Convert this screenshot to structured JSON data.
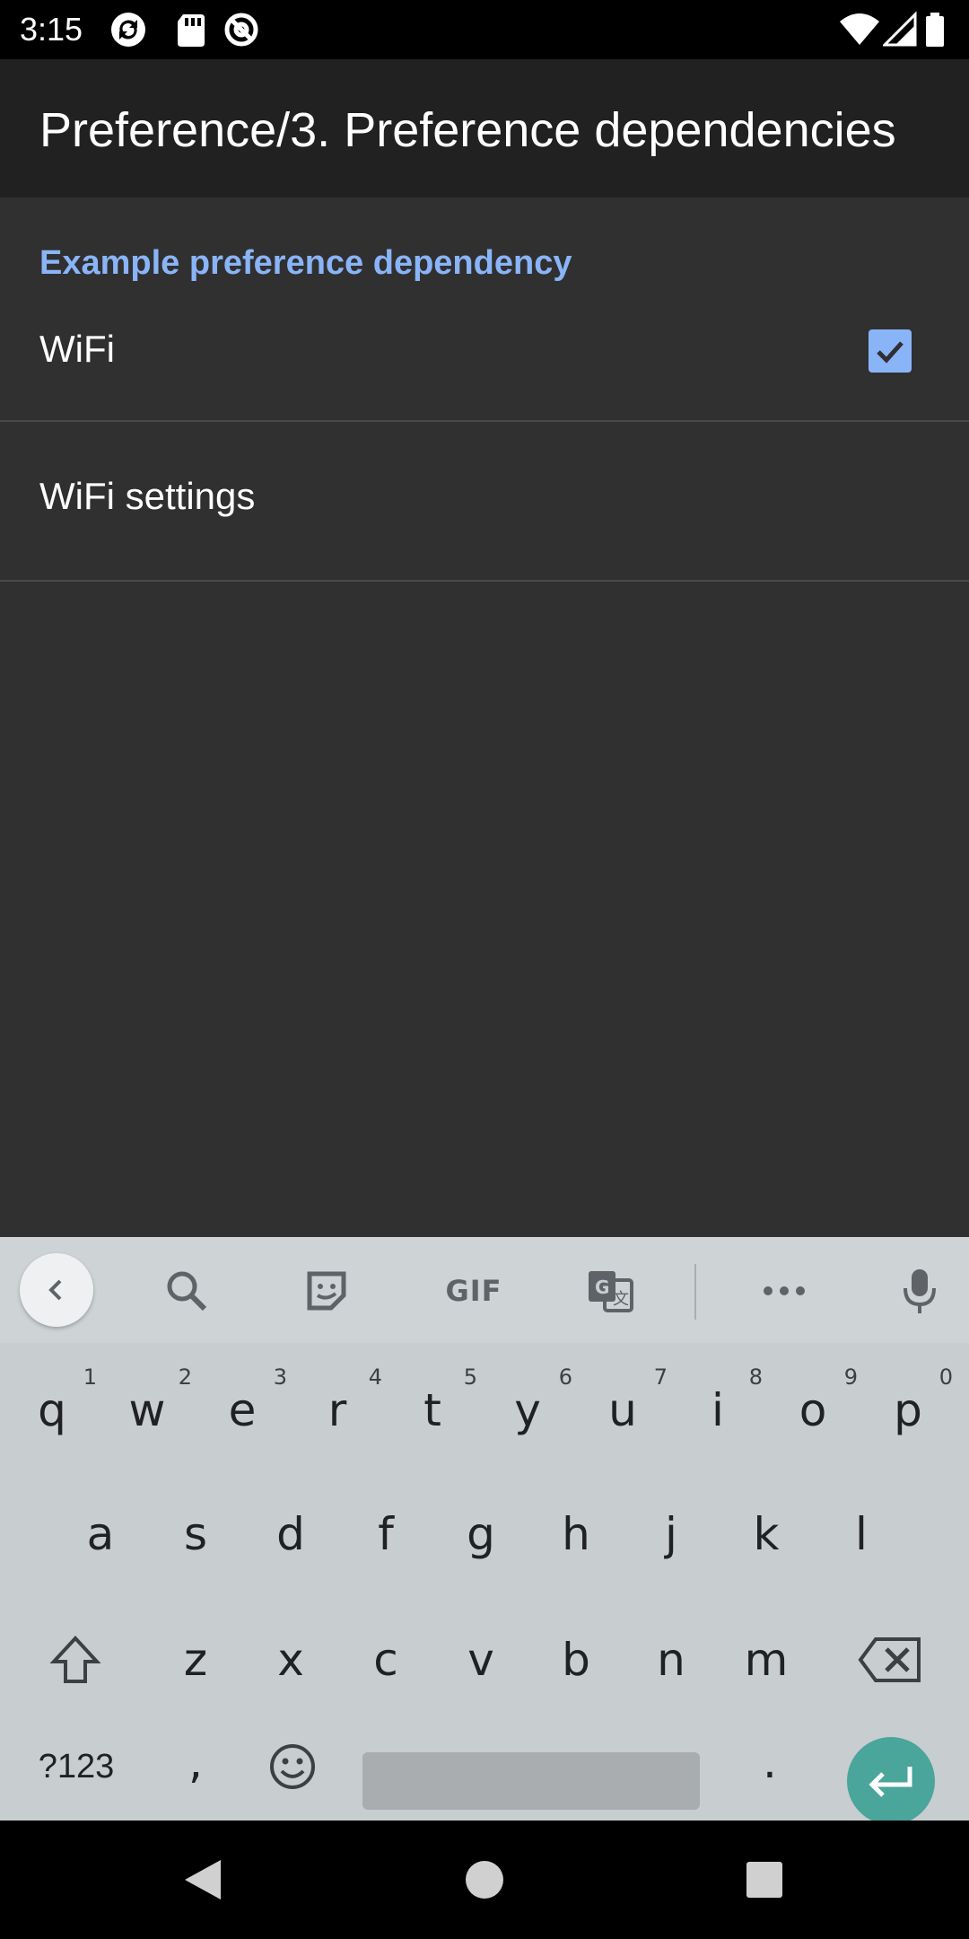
{
  "status_bar": {
    "time": "3:15",
    "left_icons": [
      "sync-icon",
      "sd-card-icon",
      "at-sign-icon"
    ],
    "right_icons": [
      "wifi-icon",
      "signal-icon",
      "battery-icon"
    ]
  },
  "app_bar": {
    "title": "Preference/3. Preference dependencies"
  },
  "preferences": {
    "category_title": "Example preference dependency",
    "items": [
      {
        "title": "WiFi",
        "checked": true
      },
      {
        "title": "WiFi settings"
      }
    ]
  },
  "keyboard": {
    "toolbar": [
      "back-icon",
      "search-icon",
      "sticker-icon",
      "GIF",
      "translate-icon",
      "more-icon",
      "mic-icon"
    ],
    "gif_label": "GIF",
    "row1": [
      {
        "key": "q",
        "hint": "1"
      },
      {
        "key": "w",
        "hint": "2"
      },
      {
        "key": "e",
        "hint": "3"
      },
      {
        "key": "r",
        "hint": "4"
      },
      {
        "key": "t",
        "hint": "5"
      },
      {
        "key": "y",
        "hint": "6"
      },
      {
        "key": "u",
        "hint": "7"
      },
      {
        "key": "i",
        "hint": "8"
      },
      {
        "key": "o",
        "hint": "9"
      },
      {
        "key": "p",
        "hint": "0"
      }
    ],
    "row2": [
      "a",
      "s",
      "d",
      "f",
      "g",
      "h",
      "j",
      "k",
      "l"
    ],
    "row3": [
      "z",
      "x",
      "c",
      "v",
      "b",
      "n",
      "m"
    ],
    "symbols_label": "?123",
    "comma": ",",
    "period": "."
  },
  "colors": {
    "accent": "#8ab4f8",
    "background": "#303030",
    "app_bar": "#212121",
    "enter_key": "#4aa59a"
  }
}
